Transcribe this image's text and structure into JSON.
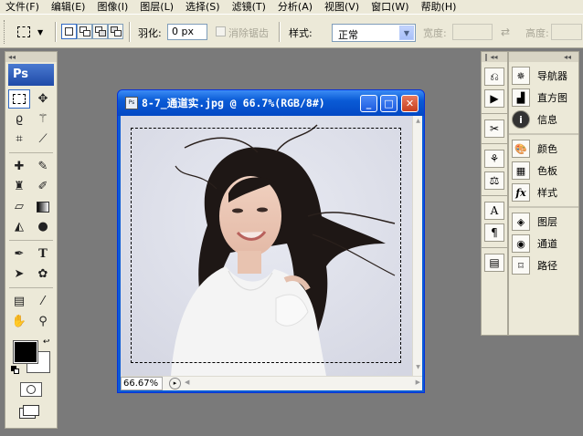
{
  "menubar": {
    "items": [
      "文件(F)",
      "编辑(E)",
      "图像(I)",
      "图层(L)",
      "选择(S)",
      "滤镜(T)",
      "分析(A)",
      "视图(V)",
      "窗口(W)",
      "帮助(H)"
    ]
  },
  "options": {
    "feather_label": "羽化:",
    "feather_value": "0 px",
    "antialias_label": "消除锯齿",
    "style_label": "样式:",
    "style_value": "正常",
    "width_label": "宽度:",
    "height_label": "高度:"
  },
  "toolbox": {
    "logo": "Ps"
  },
  "document": {
    "title": "8-7_通道实.jpg @ 66.7%(RGB/8#)",
    "zoom": "66.67%",
    "minimize": "_",
    "restore": "□",
    "close": "✕"
  },
  "panels": {
    "group1": [
      "导航器",
      "直方图",
      "信息"
    ],
    "group2": [
      "颜色",
      "色板",
      "样式"
    ],
    "group3": [
      "图层",
      "通道",
      "路径"
    ]
  },
  "colors": {
    "foreground": "#000000",
    "background": "#ffffff",
    "title_bar": "#0a5bd6"
  }
}
